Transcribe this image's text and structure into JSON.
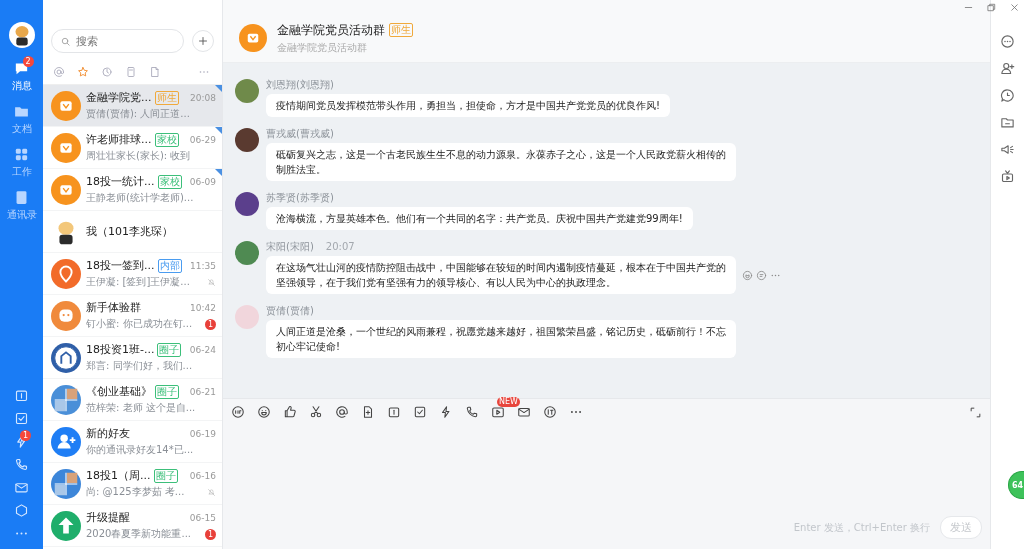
{
  "nav": {
    "items": [
      {
        "kind": "chat",
        "label": "消息",
        "selected": true,
        "badge": "2"
      },
      {
        "kind": "folder",
        "label": "文档",
        "selected": false
      },
      {
        "kind": "grid",
        "label": "工作",
        "selected": false
      },
      {
        "kind": "contact",
        "label": "通讯录",
        "selected": false
      }
    ],
    "tools": [
      {
        "kind": "calendar"
      },
      {
        "kind": "checkbox"
      },
      {
        "kind": "lightning",
        "badge": "1"
      },
      {
        "kind": "phone"
      },
      {
        "kind": "mail"
      },
      {
        "kind": "cube"
      },
      {
        "kind": "dots"
      }
    ]
  },
  "search": {
    "placeholder": "搜索"
  },
  "filters": [
    {
      "kind": "at",
      "selected": false
    },
    {
      "kind": "star",
      "selected": true
    },
    {
      "kind": "clock",
      "selected": false
    },
    {
      "kind": "doc",
      "selected": false
    },
    {
      "kind": "file",
      "selected": false
    },
    {
      "kind": "dots",
      "selected": false
    }
  ],
  "conversations": [
    {
      "name": "金融学院党...",
      "tag": {
        "label": "师生",
        "color": "#f0a93b"
      },
      "time": "20:08",
      "preview": "贾倩(贾倩): 人间正道...",
      "avatar": {
        "kind": "group",
        "color": "#f7931e"
      },
      "selected": true,
      "pinned": true,
      "muted": false
    },
    {
      "name": "许老师排球...",
      "tag": {
        "label": "家校",
        "color": "#3cbf7a"
      },
      "time": "06-29",
      "preview": "周壮壮家长(家长): 收到",
      "avatar": {
        "kind": "group",
        "color": "#f7931e"
      },
      "selected": false,
      "pinned": true,
      "muted": false
    },
    {
      "name": "18投一统计...",
      "tag": {
        "label": "家校",
        "color": "#3cbf7a"
      },
      "time": "06-09",
      "preview": "王静老师(统计学老师)...",
      "avatar": {
        "kind": "group",
        "color": "#f7931e"
      },
      "selected": false,
      "pinned": true,
      "muted": false
    },
    {
      "name": "我（101李兆琛）",
      "avatar": {
        "kind": "mascot",
        "color": "#f3c77a"
      },
      "selected": false,
      "pinned": false,
      "muted": false
    },
    {
      "name": "18投一签到...",
      "tag": {
        "label": "内部",
        "color": "#4a9cf0"
      },
      "time": "11:35",
      "preview": "王伊凝: [签到]王伊凝...",
      "avatar": {
        "kind": "pin",
        "color": "#f26b2a"
      },
      "selected": false,
      "pinned": false,
      "muted": true
    },
    {
      "name": "新手体验群",
      "time": "10:42",
      "preview": "钉小蜜: 你已成功在钉...",
      "badge": "1",
      "avatar": {
        "kind": "bot",
        "color": "#f08a3c"
      },
      "selected": false,
      "pinned": false,
      "muted": false
    },
    {
      "name": "18投资1班-...",
      "tag": {
        "label": "圈子",
        "color": "#3cbf7a"
      },
      "time": "06-24",
      "preview": "郑言: 同学们好，我们...",
      "avatar": {
        "kind": "emblem",
        "color": "#2f5fa8"
      },
      "selected": false,
      "pinned": false,
      "muted": false
    },
    {
      "name": "《创业基础》",
      "tag": {
        "label": "圈子",
        "color": "#3cbf7a"
      },
      "time": "06-21",
      "preview": "范梓荣: 老师 这个是自...",
      "avatar": {
        "kind": "photo",
        "color": "#4a8fd8"
      },
      "selected": false,
      "pinned": false,
      "muted": false
    },
    {
      "name": "新的好友",
      "time": "06-19",
      "preview": "你的通讯录好友14*已...",
      "avatar": {
        "kind": "friend",
        "color": "#1f7ef5"
      },
      "selected": false,
      "pinned": false,
      "muted": false
    },
    {
      "name": "18投1（周...",
      "tag": {
        "label": "圈子",
        "color": "#3cbf7a"
      },
      "time": "06-16",
      "preview": "尚: @125李梦茹  考...",
      "avatar": {
        "kind": "photo",
        "color": "#3d86d9"
      },
      "selected": false,
      "pinned": false,
      "muted": true
    },
    {
      "name": "升级提醒",
      "time": "06-15",
      "preview": "2020春夏季新功能重...",
      "badge": "1",
      "avatar": {
        "kind": "upgrade",
        "color": "#1fae6b"
      },
      "selected": false,
      "pinned": false,
      "muted": false
    }
  ],
  "chat": {
    "title": "金融学院党员活动群",
    "tag": {
      "label": "师生",
      "color": "#f0a93b"
    },
    "subtitle": "金融学院党员活动群",
    "messages": [
      {
        "sender": "刘恩翔(刘恩翔)",
        "text": "疫情期间党员发挥模范带头作用，勇担当，担使命，方才是中国共产党党员的优良作风!",
        "avatar": {
          "color": "#6f8a4a"
        },
        "actions": false
      },
      {
        "sender": "曹戎威(曹戎威)",
        "text": "砥砺复兴之志，这是一个古老民族生生不息的动力源泉。永葆赤子之心，这是一个人民政党薪火相传的制胜法宝。",
        "avatar": {
          "color": "#5a3a30"
        },
        "actions": false
      },
      {
        "sender": "苏季贤(苏季贤)",
        "text": "沧海横流，方显英雄本色。他们有一个共同的名字：共产党员。庆祝中国共产党建党99周年!",
        "avatar": {
          "color": "#5b3f8c"
        },
        "actions": false
      },
      {
        "sender": "宋阳(宋阳)",
        "time": "20:07",
        "text": "在这场气壮山河的疫情防控阻击战中，中国能够在较短的时间内遏制疫情蔓延，根本在于中国共产党的坚强领导，在于我们党有坚强有力的领导核心、有以人民为中心的执政理念。",
        "avatar": {
          "color": "#4f8a52"
        },
        "actions": true
      },
      {
        "sender": "贾倩(贾倩)",
        "text": "人间正道是沧桑，一个世纪的风雨兼程，祝愿党越来越好，祖国繁荣昌盛，铭记历史，砥砺前行！不忘初心牢记使命!",
        "avatar": {
          "color": "#f1d6dc"
        },
        "actions": false
      }
    ],
    "toolbar": [
      {
        "kind": "gif"
      },
      {
        "kind": "emoji"
      },
      {
        "kind": "thumb"
      },
      {
        "kind": "scissors"
      },
      {
        "kind": "at"
      },
      {
        "kind": "fileadd"
      },
      {
        "kind": "calendar"
      },
      {
        "kind": "checkbox"
      },
      {
        "kind": "lightning"
      },
      {
        "kind": "phone"
      },
      {
        "kind": "video",
        "badge": "NEW"
      },
      {
        "kind": "mail"
      },
      {
        "kind": "seal"
      },
      {
        "kind": "dots"
      }
    ],
    "hint": "Enter 发送，Ctrl+Enter 换行",
    "send_button": {
      "label": "发送",
      "disabled": true
    }
  },
  "right_bar": [
    {
      "kind": "morecircle"
    },
    {
      "kind": "personadd"
    },
    {
      "kind": "chatclock"
    },
    {
      "kind": "folderline"
    },
    {
      "kind": "megaphone"
    },
    {
      "kind": "tv"
    }
  ],
  "floating_ball": {
    "label": "64"
  }
}
